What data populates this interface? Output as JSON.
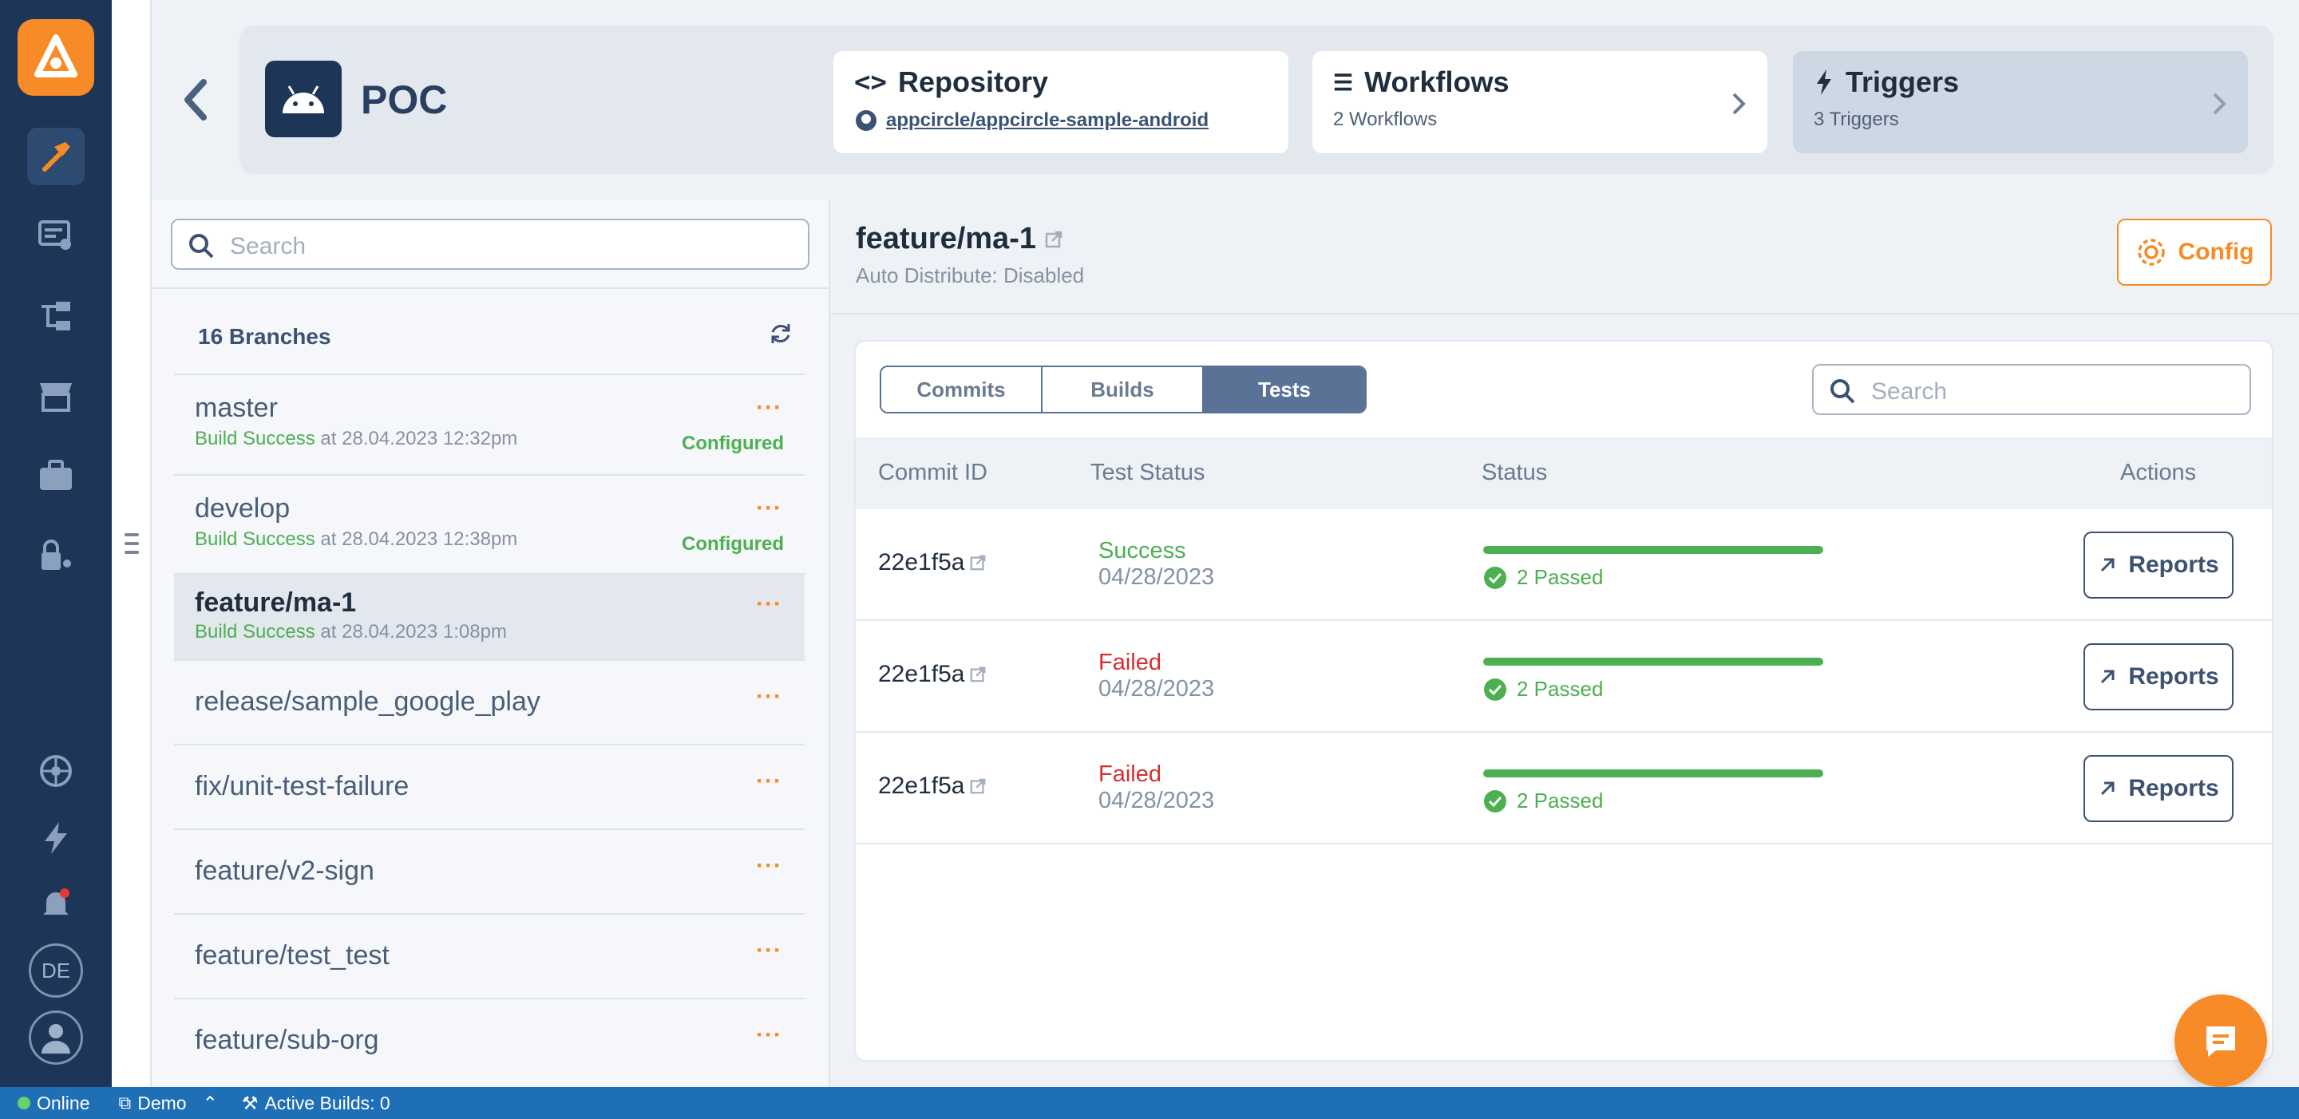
{
  "nav": {
    "avatar_initials": "DE",
    "items": [
      "build-icon",
      "distribute-icon",
      "testing-icon",
      "store-icon",
      "enterprise-icon",
      "signing-icon",
      "integrations-icon",
      "trigger-icon",
      "notifications-icon"
    ]
  },
  "header": {
    "app_title": "POC",
    "repository": {
      "title": "Repository",
      "link": "appcircle/appcircle-sample-android"
    },
    "workflows": {
      "title": "Workflows",
      "subtitle": "2 Workflows"
    },
    "triggers": {
      "title": "Triggers",
      "subtitle": "3 Triggers"
    }
  },
  "branches": {
    "search_placeholder": "Search",
    "count_label": "16 Branches",
    "items": [
      {
        "name": "master",
        "status": "Build Success",
        "at": "at 28.04.2023 12:32pm",
        "configured": "Configured"
      },
      {
        "name": "develop",
        "status": "Build Success",
        "at": "at 28.04.2023 12:38pm",
        "configured": "Configured"
      },
      {
        "name": "feature/ma-1",
        "status": "Build Success",
        "at": "at 28.04.2023 1:08pm",
        "configured": ""
      },
      {
        "name": "release/sample_google_play"
      },
      {
        "name": "fix/unit-test-failure"
      },
      {
        "name": "feature/v2-sign"
      },
      {
        "name": "feature/test_test"
      },
      {
        "name": "feature/sub-org"
      }
    ],
    "more_label": "···"
  },
  "main": {
    "branch_title": "feature/ma-1",
    "auto_distribute": "Auto Distribute: Disabled",
    "config_label": "Config",
    "tabs": [
      "Commits",
      "Builds",
      "Tests"
    ],
    "active_tab": "Tests",
    "search_placeholder": "Search",
    "columns": [
      "Commit ID",
      "Test Status",
      "Status",
      "Actions"
    ],
    "rows": [
      {
        "commit": "22e1f5a",
        "test_status": "Success",
        "date": "04/28/2023",
        "passed": "2 Passed",
        "progress": 1.0,
        "action": "Reports"
      },
      {
        "commit": "22e1f5a",
        "test_status": "Failed",
        "date": "04/28/2023",
        "passed": "2 Passed",
        "progress": 1.0,
        "action": "Reports"
      },
      {
        "commit": "22e1f5a",
        "test_status": "Failed",
        "date": "04/28/2023",
        "passed": "2 Passed",
        "progress": 1.0,
        "action": "Reports"
      }
    ]
  },
  "statusbar": {
    "online": "Online",
    "org": "Demo",
    "active_builds": "Active Builds: 0"
  },
  "colors": {
    "accent": "#f68b27",
    "nav": "#1d3557",
    "success": "#4caf50",
    "failed": "#d32f2f",
    "statusbar": "#1f6fb7"
  }
}
